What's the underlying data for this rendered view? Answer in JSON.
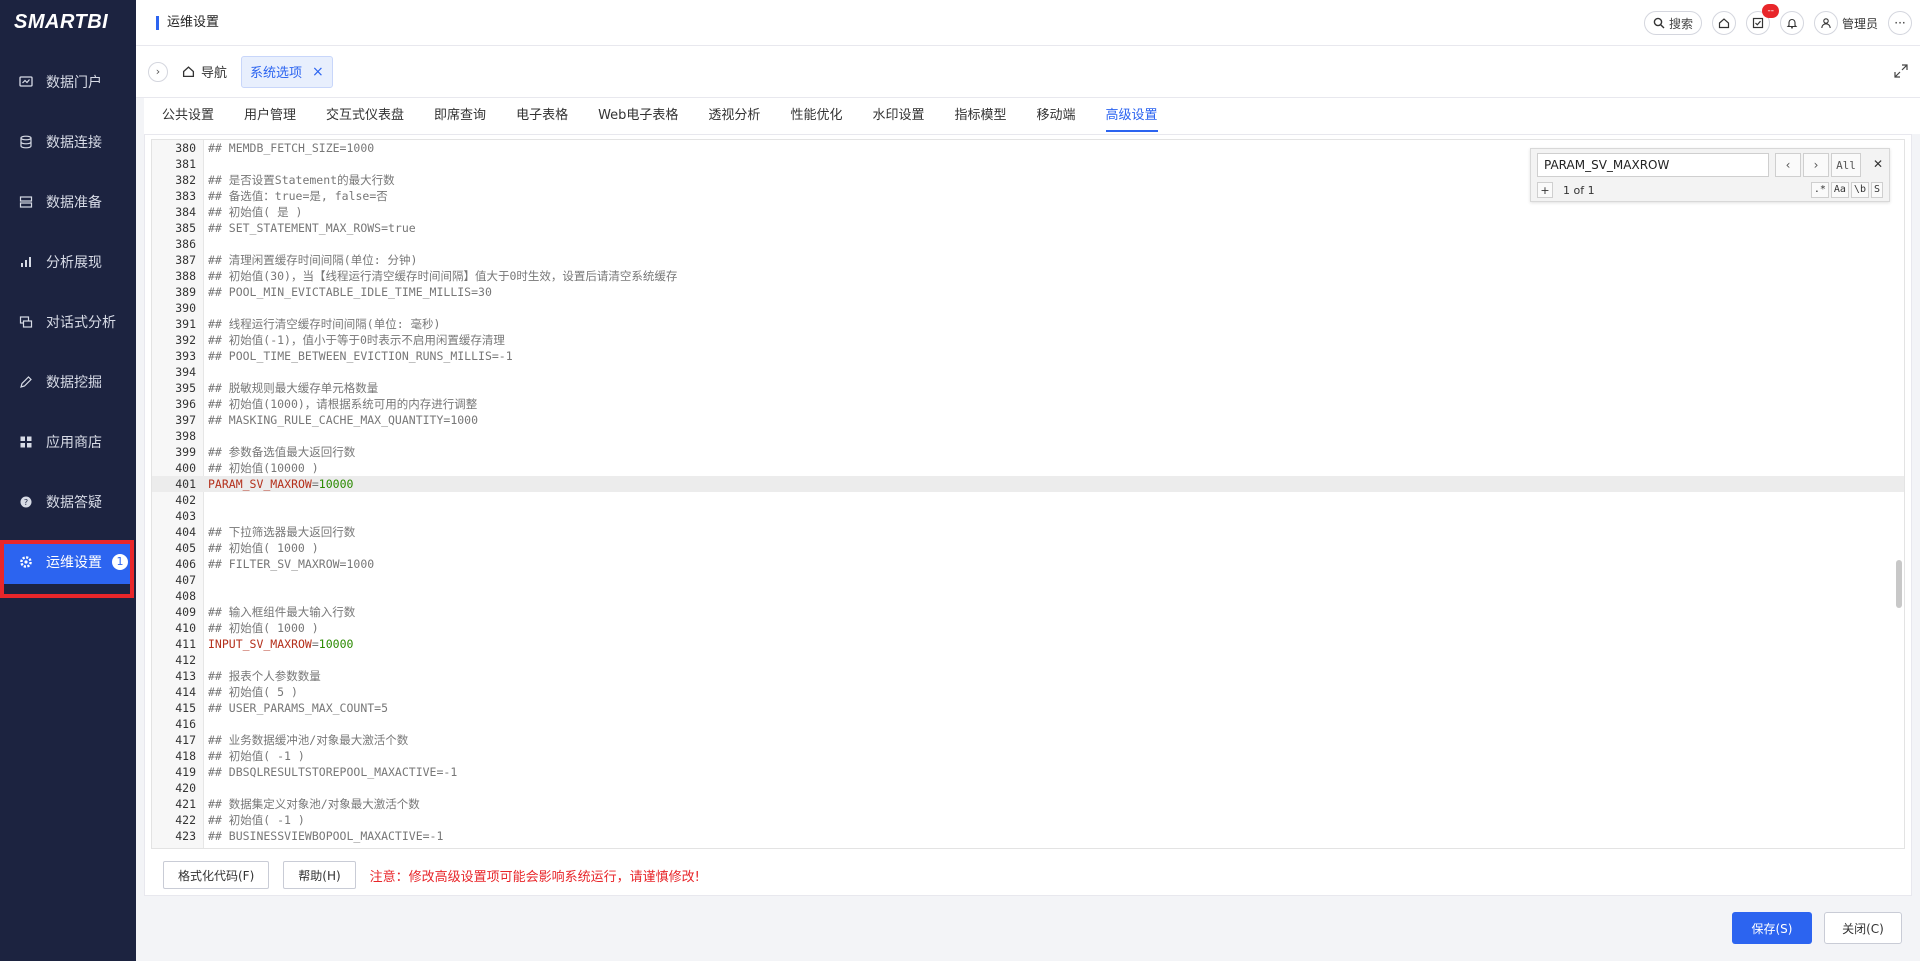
{
  "app": {
    "logo": "SMARTBI"
  },
  "sidebar": {
    "items": [
      {
        "label": "数据门户",
        "icon": "dashboard-icon"
      },
      {
        "label": "数据连接",
        "icon": "database-icon"
      },
      {
        "label": "数据准备",
        "icon": "server-icon"
      },
      {
        "label": "分析展现",
        "icon": "bar-chart-icon"
      },
      {
        "label": "对话式分析",
        "icon": "chat-icon"
      },
      {
        "label": "数据挖掘",
        "icon": "pen-icon"
      },
      {
        "label": "应用商店",
        "icon": "apps-icon"
      },
      {
        "label": "数据答疑",
        "icon": "question-icon"
      },
      {
        "label": "运维设置",
        "icon": "gear-icon",
        "badge": "1",
        "active": true
      }
    ]
  },
  "header": {
    "title": "运维设置",
    "search_label": "搜索",
    "notif_badge": "--",
    "user_label": "管理员"
  },
  "tabbar": {
    "home_label": "导航",
    "doc_tab_label": "系统选项",
    "close_glyph": "×"
  },
  "subtabs": [
    "公共设置",
    "用户管理",
    "交互式仪表盘",
    "即席查询",
    "电子表格",
    "Web电子表格",
    "透视分析",
    "性能优化",
    "水印设置",
    "指标模型",
    "移动端",
    "高级设置"
  ],
  "active_subtab": "高级设置",
  "find": {
    "query": "PARAM_SV_MAXROW",
    "all_label": "All",
    "plus": "+",
    "count": "1 of 1",
    "opts": [
      ".*",
      "Aa",
      "\\b",
      "S"
    ]
  },
  "editor": {
    "current_line": 401,
    "lines": [
      {
        "n": "380",
        "t": "## MEMDB_FETCH_SIZE=1000"
      },
      {
        "n": "381",
        "t": ""
      },
      {
        "n": "382",
        "t": "## 是否设置Statement的最大行数"
      },
      {
        "n": "383",
        "t": "## 备选值：true=是, false=否"
      },
      {
        "n": "384",
        "t": "## 初始值( 是 )"
      },
      {
        "n": "385",
        "t": "## SET_STATEMENT_MAX_ROWS=true"
      },
      {
        "n": "386",
        "t": ""
      },
      {
        "n": "387",
        "t": "## 清理闲置缓存时间间隔(单位: 分钟)"
      },
      {
        "n": "388",
        "t": "## 初始值(30)，当【线程运行清空缓存时间间隔】值大于0时生效，设置后请清空系统缓存"
      },
      {
        "n": "389",
        "t": "## POOL_MIN_EVICTABLE_IDLE_TIME_MILLIS=30"
      },
      {
        "n": "390",
        "t": ""
      },
      {
        "n": "391",
        "t": "## 线程运行清空缓存时间间隔(单位: 毫秒)"
      },
      {
        "n": "392",
        "t": "## 初始值(-1)，值小于等于0时表示不启用闲置缓存清理"
      },
      {
        "n": "393",
        "t": "## POOL_TIME_BETWEEN_EVICTION_RUNS_MILLIS=-1"
      },
      {
        "n": "394",
        "t": ""
      },
      {
        "n": "395",
        "t": "## 脱敏规则最大缓存单元格数量"
      },
      {
        "n": "396",
        "t": "## 初始值(1000)，请根据系统可用的内存进行调整"
      },
      {
        "n": "397",
        "t": "## MASKING_RULE_CACHE_MAX_QUANTITY=1000"
      },
      {
        "n": "398",
        "t": ""
      },
      {
        "n": "399",
        "t": "## 参数备选值最大返回行数"
      },
      {
        "n": "400",
        "t": "## 初始值(10000 )"
      },
      {
        "n": "401",
        "k": "PARAM_SV_MAXROW",
        "v": "10000"
      },
      {
        "n": "402",
        "t": ""
      },
      {
        "n": "403",
        "t": ""
      },
      {
        "n": "404",
        "t": "## 下拉筛选器最大返回行数"
      },
      {
        "n": "405",
        "t": "## 初始值( 1000 )"
      },
      {
        "n": "406",
        "t": "## FILTER_SV_MAXROW=1000"
      },
      {
        "n": "407",
        "t": ""
      },
      {
        "n": "408",
        "t": ""
      },
      {
        "n": "409",
        "t": "## 输入框组件最大输入行数"
      },
      {
        "n": "410",
        "t": "## 初始值( 1000 )"
      },
      {
        "n": "411",
        "k": "INPUT_SV_MAXROW",
        "v": "10000"
      },
      {
        "n": "412",
        "t": ""
      },
      {
        "n": "413",
        "t": "## 报表个人参数数量"
      },
      {
        "n": "414",
        "t": "## 初始值( 5 )"
      },
      {
        "n": "415",
        "t": "## USER_PARAMS_MAX_COUNT=5"
      },
      {
        "n": "416",
        "t": ""
      },
      {
        "n": "417",
        "t": "## 业务数据缓冲池/对象最大激活个数"
      },
      {
        "n": "418",
        "t": "## 初始值( -1 )"
      },
      {
        "n": "419",
        "t": "## DBSQLRESULTSTOREPOOL_MAXACTIVE=-1"
      },
      {
        "n": "420",
        "t": ""
      },
      {
        "n": "421",
        "t": "## 数据集定义对象池/对象最大激活个数"
      },
      {
        "n": "422",
        "t": "## 初始值( -1 )"
      },
      {
        "n": "423",
        "t": "## BUSINESSVIEWBOPOOL_MAXACTIVE=-1"
      }
    ]
  },
  "footer": {
    "format_button": "格式化代码(F)",
    "help_button": "帮助(H)",
    "warning": "注意：修改高级设置项可能会影响系统运行，请谨慎修改!",
    "save_button": "保存(S)",
    "close_button": "关闭(C)"
  },
  "colors": {
    "sidebar_bg": "#1c2340",
    "accent": "#2c64f0",
    "highlight_box": "#e8262a"
  }
}
